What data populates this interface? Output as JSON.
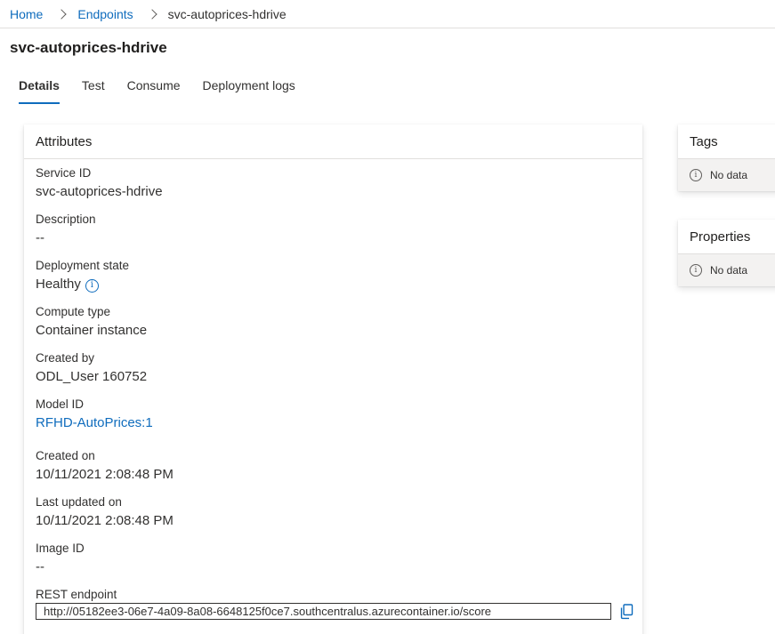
{
  "breadcrumb": {
    "home": "Home",
    "endpoints": "Endpoints",
    "current": "svc-autoprices-hdrive"
  },
  "page_title": "svc-autoprices-hdrive",
  "tabs": [
    {
      "label": "Details",
      "active": true
    },
    {
      "label": "Test",
      "active": false
    },
    {
      "label": "Consume",
      "active": false
    },
    {
      "label": "Deployment logs",
      "active": false
    }
  ],
  "attributes": {
    "header": "Attributes",
    "service_id": {
      "label": "Service ID",
      "value": "svc-autoprices-hdrive"
    },
    "description": {
      "label": "Description",
      "value": "--"
    },
    "deployment_state": {
      "label": "Deployment state",
      "value": "Healthy"
    },
    "compute_type": {
      "label": "Compute type",
      "value": "Container instance"
    },
    "created_by": {
      "label": "Created by",
      "value": "ODL_User 160752"
    },
    "model_id": {
      "label": "Model ID",
      "value": "RFHD-AutoPrices:1"
    },
    "created_on": {
      "label": "Created on",
      "value": "10/11/2021 2:08:48 PM"
    },
    "last_updated_on": {
      "label": "Last updated on",
      "value": "10/11/2021 2:08:48 PM"
    },
    "image_id": {
      "label": "Image ID",
      "value": "--"
    },
    "rest_endpoint": {
      "label": "REST endpoint",
      "value": "http://05182ee3-06e7-4a09-8a08-6648125f0ce7.southcentralus.azurecontainer.io/score"
    }
  },
  "tags": {
    "header": "Tags",
    "empty_text": "No data"
  },
  "properties": {
    "header": "Properties",
    "empty_text": "No data"
  },
  "colors": {
    "link": "#0f6cbd",
    "text": "#323130",
    "panel_bg": "#f3f2f1"
  },
  "icons": {
    "breadcrumb_separator": "chevron-right-icon",
    "info": "info-icon",
    "copy": "copy-icon"
  }
}
